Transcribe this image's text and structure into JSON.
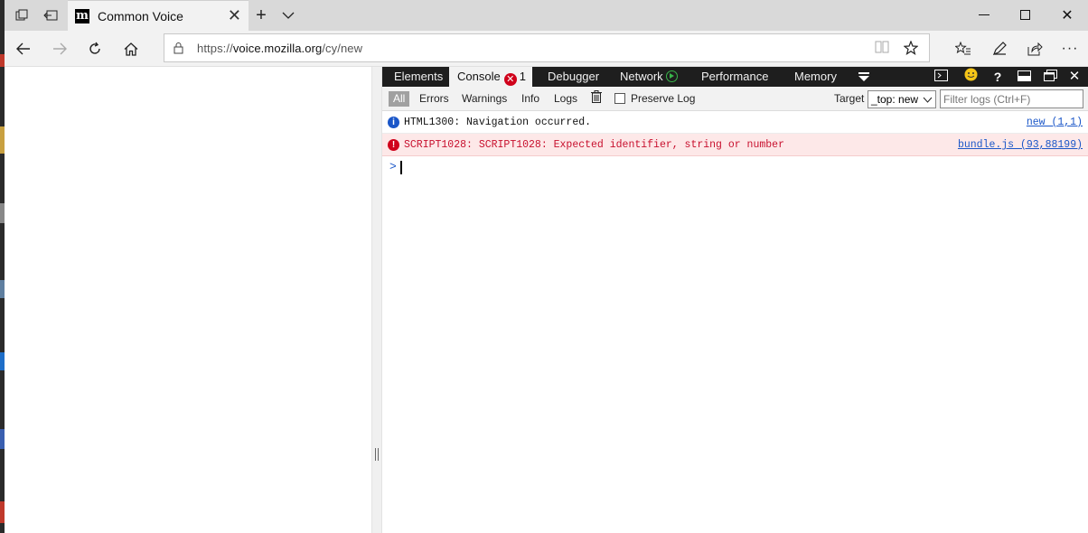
{
  "browser": {
    "tab_title": "Common Voice",
    "favicon_letter": "m",
    "address": {
      "scheme": "https://",
      "host": "voice.mozilla.org",
      "path": "/cy/new"
    }
  },
  "devtools": {
    "tabs": [
      "Elements",
      "Console",
      "Debugger",
      "Network",
      "Performance",
      "Memory"
    ],
    "console_error_count": "1",
    "filters": {
      "all": "All",
      "errors": "Errors",
      "warnings": "Warnings",
      "info": "Info",
      "logs": "Logs",
      "preserve_log": "Preserve Log"
    },
    "target_label": "Target",
    "target_value": "_top: new",
    "filter_placeholder": "Filter logs (Ctrl+F)",
    "logs": [
      {
        "level": "info",
        "message": "HTML1300: Navigation occurred.",
        "source": "new (1,1)"
      },
      {
        "level": "error",
        "message": "SCRIPT1028: SCRIPT1028: Expected identifier, string or number",
        "source": "bundle.js (93,88199)"
      }
    ],
    "prompt_glyph": ">"
  },
  "colors": {
    "devtools_bar": "#1e1e1e",
    "error_red": "#d0021b",
    "info_blue": "#1a56c8",
    "error_row_bg": "#fde8e8"
  }
}
